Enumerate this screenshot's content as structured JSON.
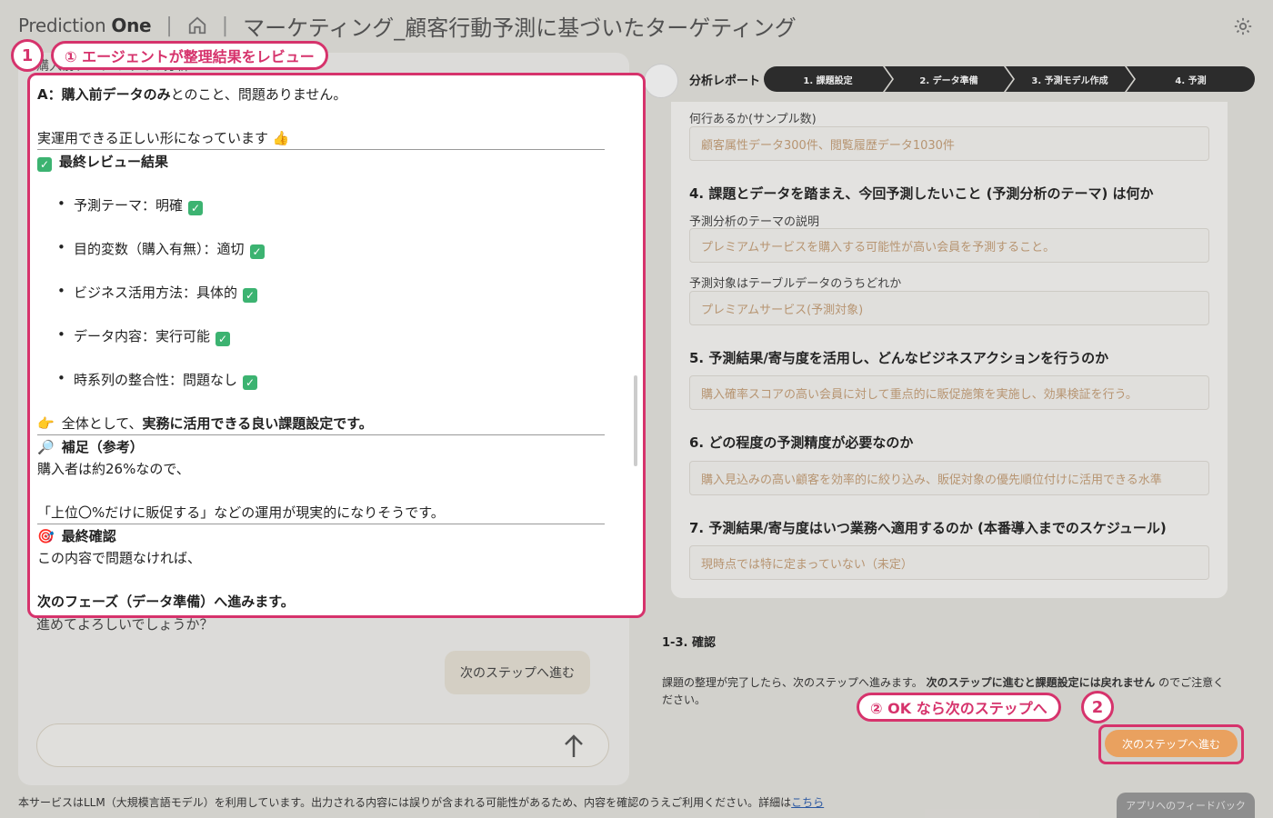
{
  "header": {
    "logo_prefix": "Prediction",
    "logo_suffix": "One",
    "sep1": "|",
    "sep2": "|",
    "title": "マーケティング_顧客行動予測に基づいたターゲティング"
  },
  "chat": {
    "behind_top": "購入前データのみでの分析",
    "behind_bottom": "進めてよろしいでしょうか？",
    "user_bubble": "次のステップへ進む",
    "input_placeholder": ""
  },
  "review": {
    "line_a_bold": "A：購入前データのみ",
    "line_a_rest": "とのこと、問題ありません。",
    "line_b": "実運用できる正しい形になっています 👍",
    "final_title": "最終レビュー結果",
    "bullets": [
      "予測テーマ：明確",
      "目的変数（購入有無）：適切",
      "ビジネス活用方法：具体的",
      "データ内容：実行可能",
      "時系列の整合性：問題なし"
    ],
    "overall_prefix": "全体として、",
    "overall_bold": "実務に活用できる良い課題設定です。",
    "supplement_title": "補足（参考）",
    "supplement_line1": "購入者は約26%なので、",
    "supplement_line2": "「上位〇%だけに販促する」などの運用が現実的になりそうです。",
    "confirm_title": "最終確認",
    "confirm_line1": "この内容で問題なければ、",
    "confirm_line2": "次のフェーズ（データ準備）へ進みます。"
  },
  "annotations": {
    "badge1": "1",
    "callout1": "① エージェントが整理結果をレビュー",
    "badge2": "2",
    "callout2": "② OK なら次のステップへ"
  },
  "report": {
    "label": "分析レポート",
    "steps": [
      "1. 課題設定",
      "2. データ準備",
      "3. 予測モデル作成",
      "4. 予測"
    ]
  },
  "form": {
    "rows_label": "何行あるか(サンプル数)",
    "rows_value": "顧客属性データ300件、閲覧履歴データ1030件",
    "q4": "4. 課題とデータを踏まえ、今回予測したいこと (予測分析のテーマ) は何か",
    "theme_label": "予測分析のテーマの説明",
    "theme_value": "プレミアムサービスを購入する可能性が高い会員を予測すること。",
    "target_label": "予測対象はテーブルデータのうちどれか",
    "target_value": "プレミアムサービス(予測対象)",
    "q5": "5. 予測結果/寄与度を活用し、どんなビジネスアクションを行うのか",
    "q5_value": "購入確率スコアの高い会員に対して重点的に販促施策を実施し、効果検証を行う。",
    "q6": "6. どの程度の予測精度が必要なのか",
    "q6_value": "購入見込みの高い顧客を効率的に絞り込み、販促対象の優先順位付けに活用できる水準",
    "q7": "7. 予測結果/寄与度はいつ業務へ適用するのか (本番導入までのスケジュール)",
    "q7_value": "現時点では特に定まっていない（未定）"
  },
  "confirm": {
    "title": "1-3. 確認",
    "text_prefix": "課題の整理が完了したら、次のステップへ進みます。",
    "text_bold": "次のステップに進むと課題設定には戻れません",
    "text_suffix": "のでご注意ください。",
    "next_button": "次のステップへ進む"
  },
  "footer": {
    "text": "本サービスはLLM（大規模言語モデル）を利用しています。出力される内容には誤りが含まれる可能性があるため、内容を確認のうえご利用ください。詳細は",
    "link": "こちら",
    "feedback": "アプリへのフィードバック"
  },
  "colors": {
    "accent": "#d6336c",
    "button": "#e9a15f",
    "field_text": "#c9a27a",
    "step_bg": "#2b2b2b"
  }
}
